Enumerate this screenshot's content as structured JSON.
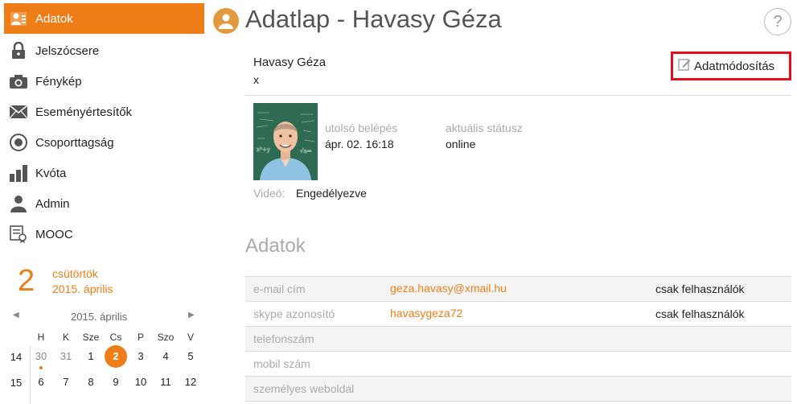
{
  "sidebar": {
    "items": [
      {
        "label": "Adatok",
        "icon": "profile-card-icon",
        "active": true
      },
      {
        "label": "Jelszócsere",
        "icon": "padlock-icon"
      },
      {
        "label": "Fénykép",
        "icon": "camera-icon"
      },
      {
        "label": "Eseményértesítők",
        "icon": "envelope-icon"
      },
      {
        "label": "Csoporttagság",
        "icon": "target-icon"
      },
      {
        "label": "Kvóta",
        "icon": "bar-chart-icon"
      },
      {
        "label": "Admin",
        "icon": "person-icon"
      },
      {
        "label": "MOOC",
        "icon": "certificate-icon"
      }
    ]
  },
  "date": {
    "day_number": "2",
    "weekday": "csütörtök",
    "month": "2015. április"
  },
  "calendar": {
    "month_label": "2015. április",
    "weekdays": [
      "H",
      "K",
      "Sze",
      "Cs",
      "P",
      "Szo",
      "V"
    ],
    "weeks": [
      {
        "number": "14",
        "days": [
          "30",
          "31",
          "1",
          "2",
          "3",
          "4",
          "5"
        ]
      },
      {
        "number": "15",
        "days": [
          "6",
          "7",
          "8",
          "9",
          "10",
          "11",
          "12"
        ]
      }
    ]
  },
  "header": {
    "title": "Adatlap - Havasy Géza",
    "help": "?"
  },
  "profile": {
    "name": "Havasy Géza",
    "sub": "x",
    "edit_label": "Adatmódosítás",
    "last_login_label": "utolsó belépés",
    "last_login_value": "ápr. 02. 16:18",
    "status_label": "aktuális státusz",
    "status_value": "online",
    "video_label": "Videó:",
    "video_value": "Engedélyezve"
  },
  "section": {
    "title": "Adatok"
  },
  "rows": [
    {
      "label": "e-mail cím",
      "value": "geza.havasy@xmail.hu",
      "visibility": "csak felhasználók"
    },
    {
      "label": "skype azonosító",
      "value": "havasygeza72",
      "visibility": "csak felhasználók"
    },
    {
      "label": "telefonszám",
      "value": "",
      "visibility": ""
    },
    {
      "label": "mobil szám",
      "value": "",
      "visibility": ""
    },
    {
      "label": "személyes weboldal",
      "value": "",
      "visibility": ""
    }
  ],
  "colors": {
    "accent": "#ee7d17",
    "highlight_border": "#e3101b"
  }
}
